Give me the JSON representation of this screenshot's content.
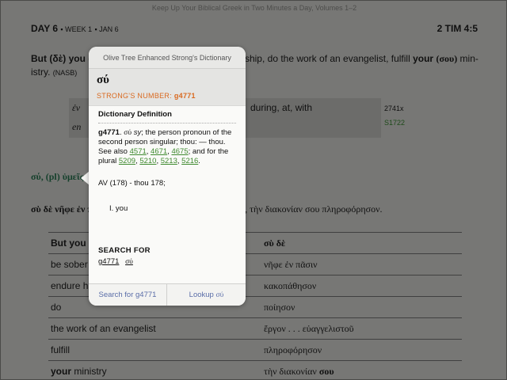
{
  "app": {
    "book_title": "Keep Up Your Biblical Greek in Two Minutes a Day, Volumes 1–2"
  },
  "header": {
    "day": "DAY 6",
    "week": "WEEK 1",
    "date": "JAN 6",
    "reference": "2 TIM 4:5"
  },
  "verse": {
    "line1_start": "But (δὲ) you (",
    "line1_end": "rdship, do the work of an evangelist, fulfill",
    "your": "your",
    "sou": "(σου)",
    "line1_tail": "min-",
    "line2": "istry.",
    "version": "(NASB)"
  },
  "parse": {
    "greek": "ἐν",
    "greek2": "en",
    "gloss": "during, at, with",
    "count": "2741x",
    "strongs": "S1722"
  },
  "pronoun_line": "σύ, (pl) ὑμεῖς",
  "greek_verse_start": "σὺ δὲ νῆφε ἐν π",
  "greek_verse_end": "ελιστοῦ, τὴν διακονίαν σου πληροφόρησον.",
  "table": {
    "headers": [
      "But you",
      "σὺ δὲ"
    ],
    "rows": [
      [
        "be sober i",
        "νῆφε ἐν πᾶσιν"
      ],
      [
        "endure ha",
        "κακοπάθησον"
      ],
      [
        "do",
        "ποίησον"
      ],
      [
        "the work of an evangelist",
        "ἔργον . . . εὐαγγελιστοῦ"
      ],
      [
        "fulfill",
        "πληροφόρησον"
      ],
      [
        "your ministry",
        "τὴν διακονίαν σου"
      ]
    ]
  },
  "popover": {
    "title": "Olive Tree Enhanced Strong's Dictionary",
    "word": "σύ",
    "strongs_label": "STRONG'S NUMBER:",
    "strongs_number": "g4771",
    "def_heading": "Dictionary Definition",
    "def_id": "g4771",
    "def_word": "σύ",
    "def_sy": "sy",
    "def_text1": "; the person pronoun of the second person singular; thou: — thou. See also",
    "see_also": [
      "4571",
      "4671",
      "4675"
    ],
    "def_text2": "; and for the plural",
    "plural": [
      "5209",
      "5210",
      "5213",
      "5216"
    ],
    "av": "AV (178) - thou 178;",
    "list_item": "I.  you",
    "search_heading": "SEARCH FOR",
    "search_terms": [
      "g4771",
      "σύ"
    ],
    "btn_search": "Search for g4771",
    "btn_lookup_prefix": "Lookup",
    "btn_lookup_word": "σύ"
  },
  "colors": {
    "accent_orange": "#d9691f",
    "link_green": "#3f8a2f",
    "button_blue": "#5a6da8"
  }
}
